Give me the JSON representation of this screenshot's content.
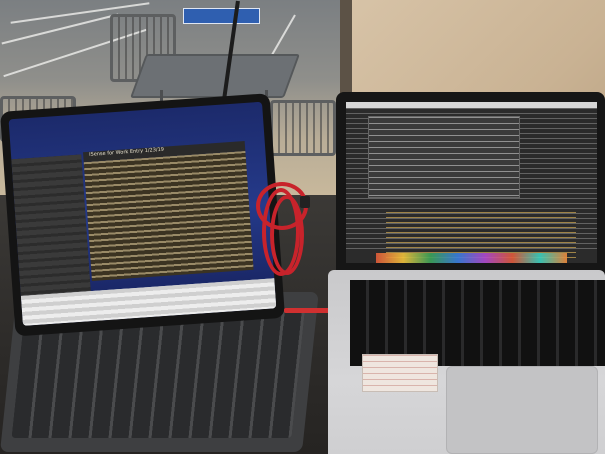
{
  "scene": {
    "ipad_document_title": "iSense for Work Entry 1/23/19"
  },
  "colors": {
    "cable": "#c8232b",
    "ipad_wallpaper": "#1c2a6b",
    "editor_dark": "#2b2b2b",
    "parking_sign": "#2f5fb0"
  }
}
